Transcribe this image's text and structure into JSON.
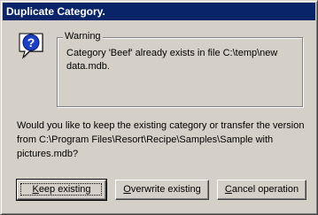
{
  "window": {
    "title": "Duplicate Category."
  },
  "warning": {
    "group_label": "Warning",
    "message": "Category 'Beef' already exists in file C:\\temp\\new data.mdb.",
    "icon": "question-icon"
  },
  "question_text": "Would you like to keep the existing category or transfer the version from C:\\Program Files\\Resort\\Recipe\\Samples\\Sample  with  pictures.mdb?",
  "buttons": {
    "keep": {
      "accel": "K",
      "rest": "eep existing"
    },
    "overwrite": {
      "accel": "O",
      "rest": "verwrite existing"
    },
    "cancel": {
      "pre": "",
      "accel": "C",
      "rest": "ancel operation"
    }
  },
  "colors": {
    "titlebar": "#0a246a",
    "face": "#d4d0c8",
    "icon_blue": "#1c3fc8"
  }
}
